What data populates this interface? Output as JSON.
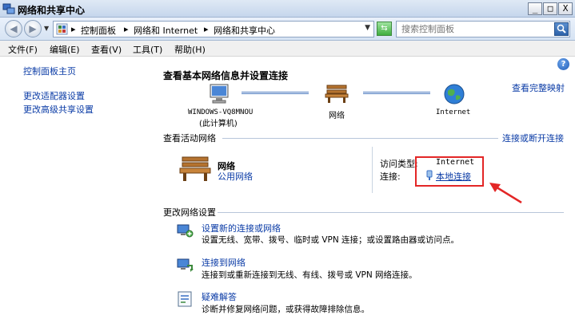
{
  "window": {
    "title": "网络和共享中心",
    "buttons": {
      "minimize": "_",
      "maximize": "□",
      "close": "X"
    }
  },
  "address_bar": {
    "crumbs": [
      "控制面板",
      "网络和 Internet",
      "网络和共享中心"
    ],
    "search_placeholder": "搜索控制面板"
  },
  "menu": {
    "items": [
      "文件(F)",
      "编辑(E)",
      "查看(V)",
      "工具(T)",
      "帮助(H)"
    ]
  },
  "left_pane": {
    "links": [
      "控制面板主页",
      "更改适配器设置",
      "更改高级共享设置"
    ]
  },
  "main": {
    "heading": "查看基本网络信息并设置连接",
    "view_full_map": "查看完整映射",
    "map": {
      "computer_name": "WINDOWS-VQ8MNOU",
      "computer_sub": "(此计算机)",
      "network": "网络",
      "internet": "Internet"
    },
    "active_networks": {
      "title": "查看活动网络",
      "connect_disconnect": "连接或断开连接",
      "network_name": "网络",
      "network_type": "公用网络",
      "access_type_label": "访问类型:",
      "access_type_value": "Internet",
      "connection_label": "连接:",
      "connection_value": "本地连接"
    },
    "change_settings": {
      "title": "更改网络设置",
      "tasks": [
        {
          "link": "设置新的连接或网络",
          "desc": "设置无线、宽带、拨号、临时或 VPN 连接；或设置路由器或访问点。"
        },
        {
          "link": "连接到网络",
          "desc": "连接到或重新连接到无线、有线、拨号或 VPN 网络连接。"
        },
        {
          "link": "疑难解答",
          "desc": "诊断并修复网络问题，或获得故障排除信息。"
        }
      ]
    }
  },
  "colors": {
    "link": "#0a3ba6",
    "highlight": "#e32626",
    "titlebar": "#c5d6ec"
  }
}
